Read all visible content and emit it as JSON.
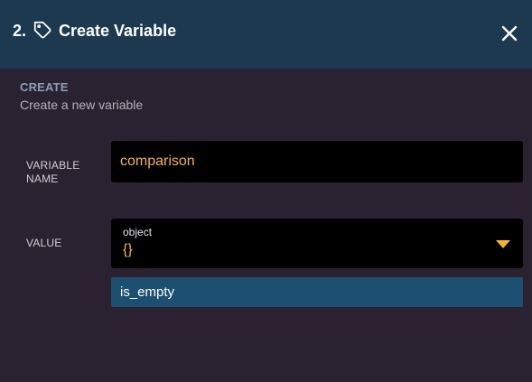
{
  "header": {
    "step_number": "2.",
    "title": "Create Variable",
    "icon": "tag-icon",
    "close_icon": "close-icon",
    "background_color": "#1c3950"
  },
  "section": {
    "heading": "CREATE",
    "description": "Create a new variable"
  },
  "form": {
    "name_label": "VARIABLE NAME",
    "name_value": "comparison",
    "value_label": "VALUE",
    "value_type": "object",
    "value_text": "{}"
  },
  "dropdown": {
    "options": [
      "is_empty"
    ]
  },
  "colors": {
    "background": "#2a2230",
    "accent": "#f5b35a",
    "option_highlight": "#1d5070"
  }
}
